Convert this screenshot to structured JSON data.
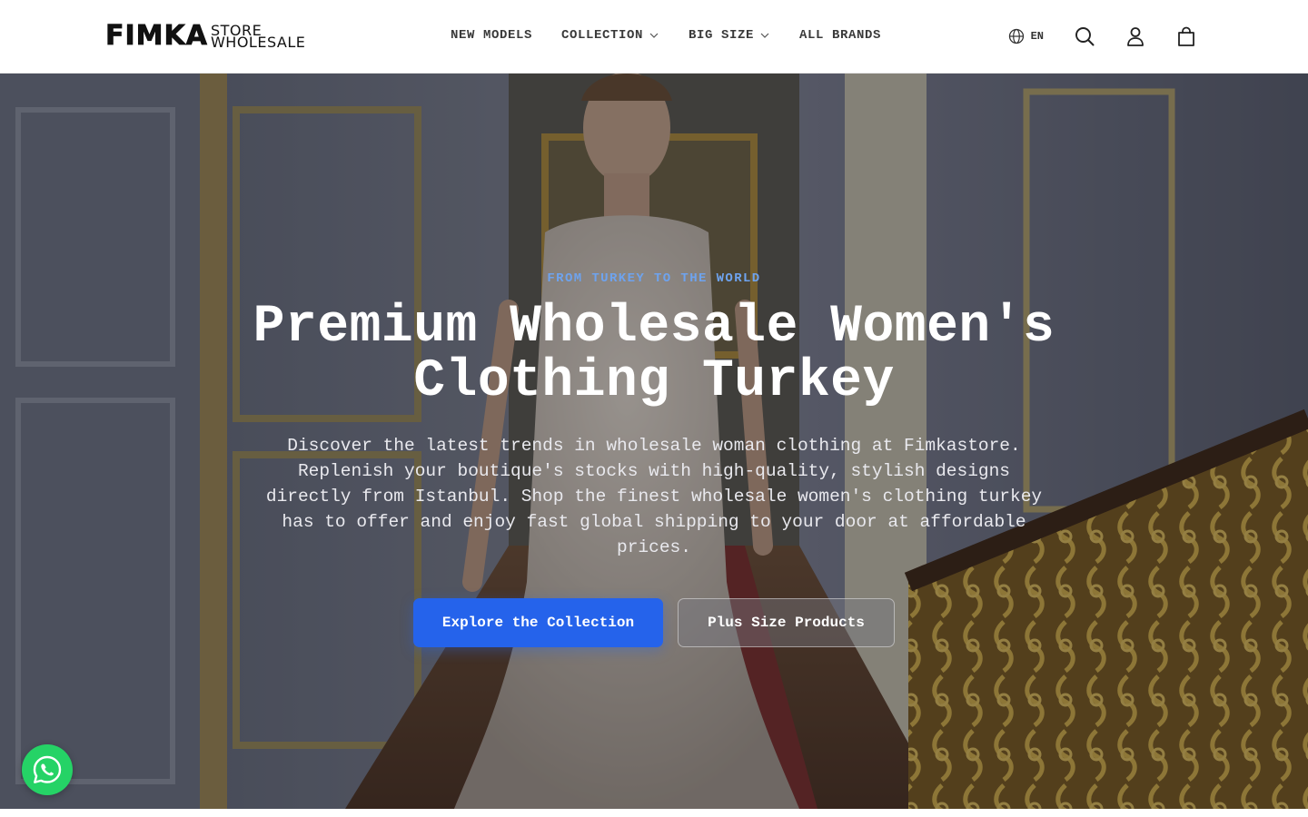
{
  "header": {
    "logo": {
      "main": "FIMKA",
      "sub_top": "STORE",
      "sub_bottom": "WHOLESALE"
    },
    "nav": [
      {
        "label": "NEW MODELS",
        "has_dropdown": false
      },
      {
        "label": "COLLECTION",
        "has_dropdown": true
      },
      {
        "label": "BIG SIZE",
        "has_dropdown": true
      },
      {
        "label": "ALL BRANDS",
        "has_dropdown": false
      }
    ],
    "language": {
      "code": "EN",
      "icon": "globe-icon"
    },
    "icons": [
      "search-icon",
      "account-icon",
      "cart-icon"
    ]
  },
  "hero": {
    "eyebrow": "FROM TURKEY TO THE WORLD",
    "title_line1": "Premium Wholesale Women's",
    "title_line2": "Clothing Turkey",
    "description": "Discover the latest trends in wholesale woman clothing at Fimkastore. Replenish your boutique's stocks with high-quality, stylish designs directly from Istanbul. Shop the finest wholesale women's clothing turkey has to offer and enjoy fast global shipping to your door at affordable prices.",
    "primary_button": "Explore the Collection",
    "secondary_button": "Plus Size Products"
  },
  "floating": {
    "chat_icon": "whatsapp-icon"
  },
  "colors": {
    "accent": "#2563eb",
    "eyebrow": "#6ea3ee",
    "whatsapp": "#25d366",
    "header_bg": "#ffffff",
    "nav_text": "#3a3a3a"
  }
}
